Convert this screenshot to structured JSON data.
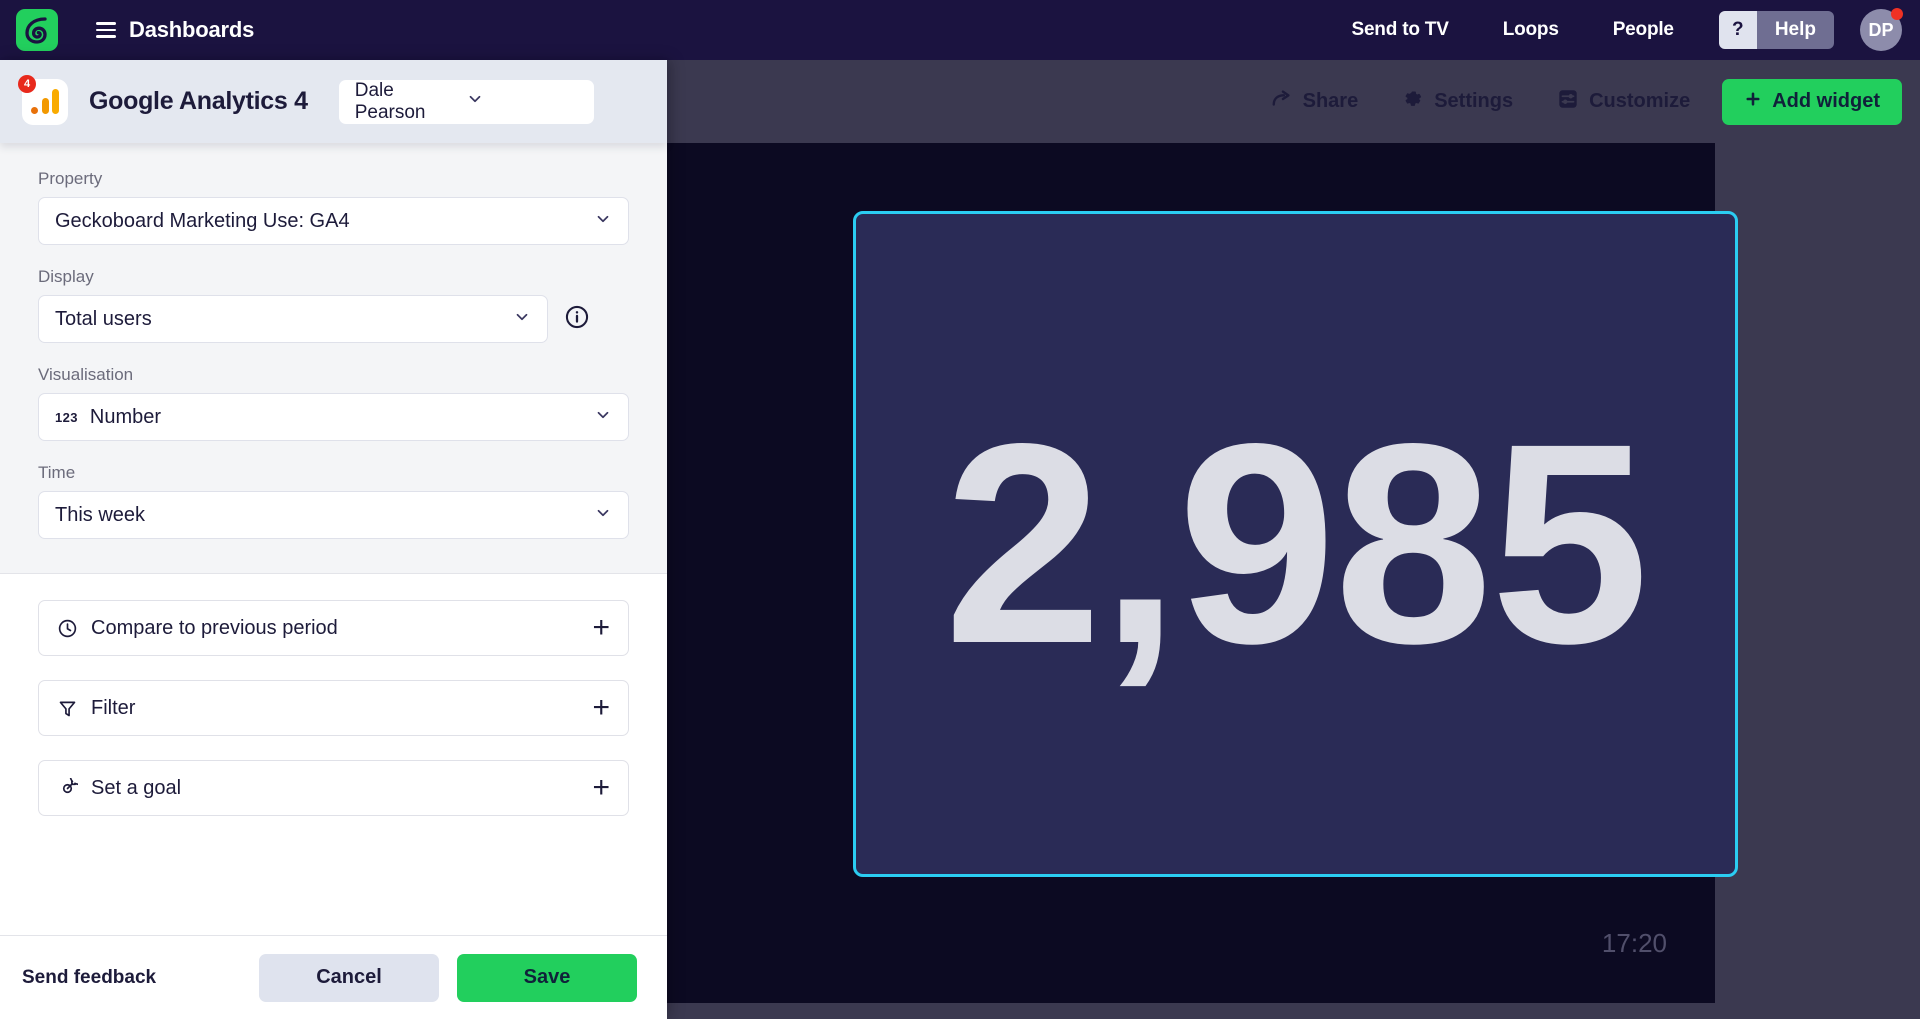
{
  "topbar": {
    "logo_icon": "geckoboard-logo-icon",
    "menu_icon": "hamburger-menu-icon",
    "title": "Dashboards",
    "nav": [
      {
        "label": "Send to TV"
      },
      {
        "label": "Loops"
      },
      {
        "label": "People"
      }
    ],
    "help": {
      "question_mark": "?",
      "label": "Help"
    },
    "avatar": {
      "initials": "DP",
      "has_notification": true
    }
  },
  "dashboard_toolbar": {
    "items": [
      {
        "label": "Share",
        "icon": "share-arrow-icon"
      },
      {
        "label": "Settings",
        "icon": "gear-icon"
      },
      {
        "label": "Customize",
        "icon": "sliders-icon"
      }
    ],
    "add_widget": {
      "label": "Add widget",
      "icon": "plus-icon",
      "color": "#22cf5d"
    }
  },
  "preview": {
    "widget_value": "2,985",
    "clock": "17:20",
    "card_border_color": "#2bcdf2",
    "card_background": "#2a2b56",
    "canvas_background": "#0c0a22"
  },
  "panel": {
    "service": {
      "name": "Google Analytics 4",
      "icon": "google-analytics-icon",
      "badge": "4"
    },
    "account": {
      "value": "Dale Pearson"
    },
    "fields": [
      {
        "label": "Property",
        "value": "Geckoboard Marketing Use: GA4",
        "has_info": false
      },
      {
        "label": "Display",
        "value": "Total users",
        "has_info": true
      },
      {
        "label": "Visualisation",
        "value": "Number",
        "badge": "123",
        "has_info": false
      },
      {
        "label": "Time",
        "value": "This week",
        "has_info": false
      }
    ],
    "options": [
      {
        "label": "Compare to previous period",
        "icon": "clock-icon",
        "action": "+"
      },
      {
        "label": "Filter",
        "icon": "funnel-icon",
        "action": "+"
      },
      {
        "label": "Set a goal",
        "icon": "target-icon",
        "action": "+"
      }
    ],
    "footer": {
      "feedback": "Send feedback",
      "cancel": "Cancel",
      "save": "Save"
    }
  }
}
